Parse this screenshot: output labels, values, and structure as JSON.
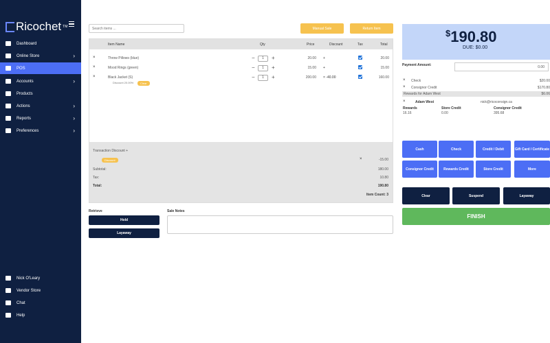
{
  "app": {
    "brand": "Ricochet"
  },
  "sidebar": {
    "items": [
      {
        "label": "Dashboard",
        "chevron": false,
        "active": false,
        "icon": "home-icon"
      },
      {
        "label": "Online Store",
        "chevron": true,
        "active": false,
        "icon": "monitor-icon"
      },
      {
        "label": "POS",
        "chevron": false,
        "active": true,
        "icon": "pos-icon"
      },
      {
        "label": "Accounts",
        "chevron": true,
        "active": false,
        "icon": "users-icon"
      },
      {
        "label": "Products",
        "chevron": false,
        "active": false,
        "icon": "tag-icon"
      },
      {
        "label": "Actions",
        "chevron": true,
        "active": false,
        "icon": "bolt-icon"
      },
      {
        "label": "Reports",
        "chevron": true,
        "active": false,
        "icon": "chart-icon"
      },
      {
        "label": "Preferences",
        "chevron": true,
        "active": false,
        "icon": "gear-icon"
      }
    ],
    "bottom": [
      {
        "label": "Nick O'Leary",
        "icon": "user-icon"
      },
      {
        "label": "Vendor Store",
        "icon": "store-icon"
      },
      {
        "label": "Chat",
        "icon": "chat-icon"
      },
      {
        "label": "Help",
        "icon": "help-icon"
      }
    ]
  },
  "search": {
    "placeholder": "Search items ..."
  },
  "buttons": {
    "manual_sale": "Manual Sale",
    "return_item": "Return Item"
  },
  "table": {
    "headers": {
      "item": "Item Name",
      "qty": "Qty",
      "price": "Price",
      "discount": "Discount",
      "tax": "Tax",
      "total": "Total"
    },
    "rows": [
      {
        "name": "Throw Pillows (blue)",
        "qty": "1",
        "price": "20.00",
        "discount": "+",
        "total": "20.00"
      },
      {
        "name": "Mood Rings (green)",
        "qty": "1",
        "price": "15.00",
        "discount": "+",
        "total": "15.00"
      },
      {
        "name": "Black Jacket (S)",
        "qty": "1",
        "price": "200.00",
        "discount": "× -40.00",
        "total": "160.00",
        "sub": "Discount 20.00%",
        "tag": "Clear"
      }
    ]
  },
  "totals": {
    "transaction_discount": "Transaction Discount +",
    "disc_tag": "Discount",
    "disc_value": "-15.00",
    "subtotal_label": "Subtotal:",
    "subtotal": "180.00",
    "tax_label": "Tax:",
    "tax": "10.80",
    "total_label": "Total:",
    "total": "190.80",
    "item_count": "Item Count: 3"
  },
  "retrieve": {
    "label": "Retrieve",
    "hold": "Hold",
    "layaway": "Layaway"
  },
  "notes": {
    "label": "Sale Notes"
  },
  "summary": {
    "currency": "$",
    "amount": "190.80",
    "due": "DUE: $0.00"
  },
  "payment": {
    "label": "Payment Amount:",
    "value": "0.00",
    "lines": [
      {
        "name": "Check",
        "amount": "$20.00"
      },
      {
        "name": "Consignor Credit",
        "amount": "$170.80"
      }
    ],
    "rewards_line": "Rewards for Adam West",
    "rewards_amount": "$6.06"
  },
  "customer": {
    "name": "Adam West",
    "email": "nick@ricoconsign.ca",
    "stats": [
      {
        "label": "Rewards",
        "value": "16.16"
      },
      {
        "label": "Store Credit",
        "value": "0.00"
      },
      {
        "label": "Consignor Credit",
        "value": "395.68"
      }
    ]
  },
  "pay_buttons": [
    "Cash",
    "Check",
    "Credit / Debit",
    "Gift Card / Certificate",
    "Consignor Credit",
    "Rewards Credit",
    "Store Credit",
    "More"
  ],
  "action_buttons": {
    "clear": "Clear",
    "suspend": "Suspend",
    "layaway": "Layaway",
    "finish": "FINISH"
  },
  "colors": {
    "sidebar": "#0f2041",
    "accent": "#4c6ef5",
    "yellow": "#f6c24f",
    "finish": "#5fb85c",
    "summary_bg": "#c3d6f9"
  }
}
